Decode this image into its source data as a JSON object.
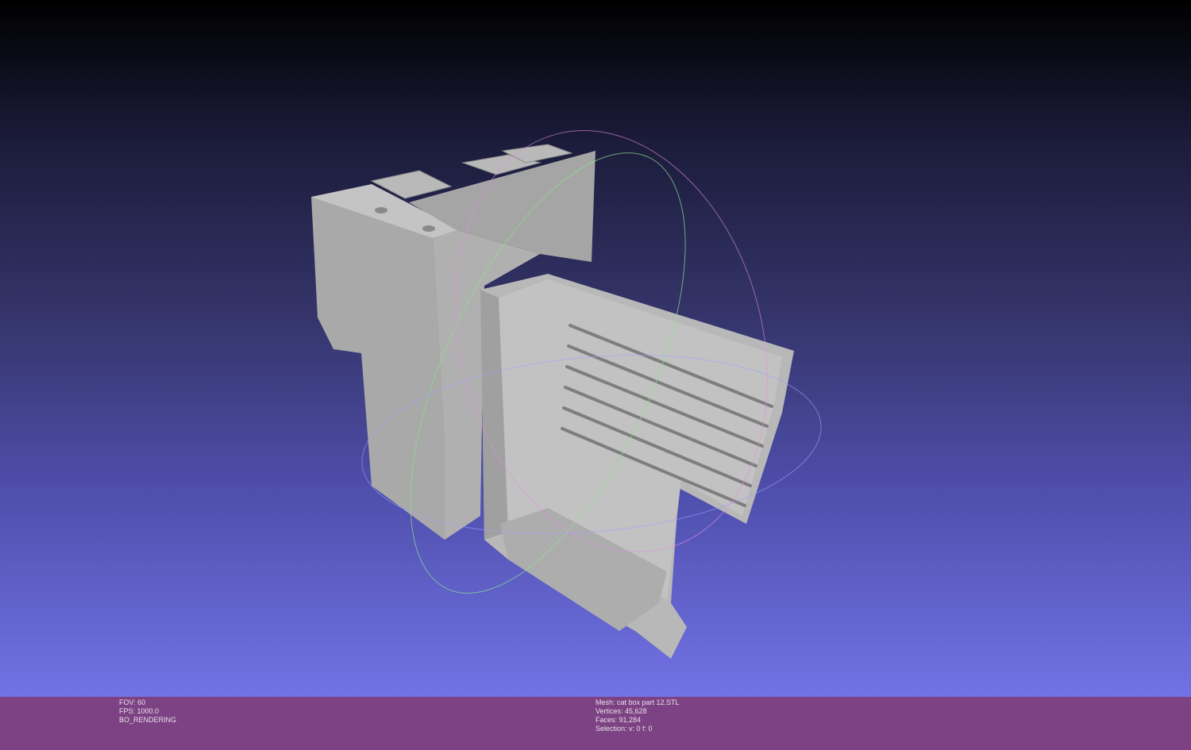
{
  "viewport": {
    "background_top": "#000000",
    "background_bottom": "#7272e6",
    "mesh_color": "#b4b4b4"
  },
  "status_left": {
    "fov": "FOV: 60",
    "fps": "FPS:  1000.0",
    "mode": "BO_RENDERING"
  },
  "status_right": {
    "mesh": "Mesh: cat box part 12.STL",
    "vertices": "Vertices: 45,628",
    "faces": "Faces: 91,284",
    "selection": "Selection: v: 0 f: 0"
  },
  "status_bar_color": "#7d4283"
}
